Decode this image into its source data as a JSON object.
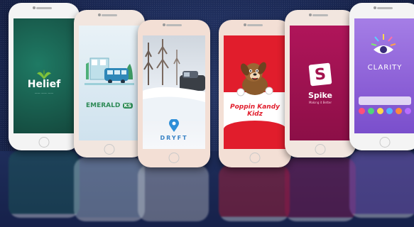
{
  "apps": [
    {
      "name": "Helief",
      "tagline": "—— —— ——"
    },
    {
      "name": "EMERALD",
      "badge": "KS"
    },
    {
      "name": "DRYFT"
    },
    {
      "name": "Poppin Kandy Kidz"
    },
    {
      "name": "Spike",
      "tagline": "Making it Better"
    },
    {
      "name": "CLARITY"
    }
  ]
}
